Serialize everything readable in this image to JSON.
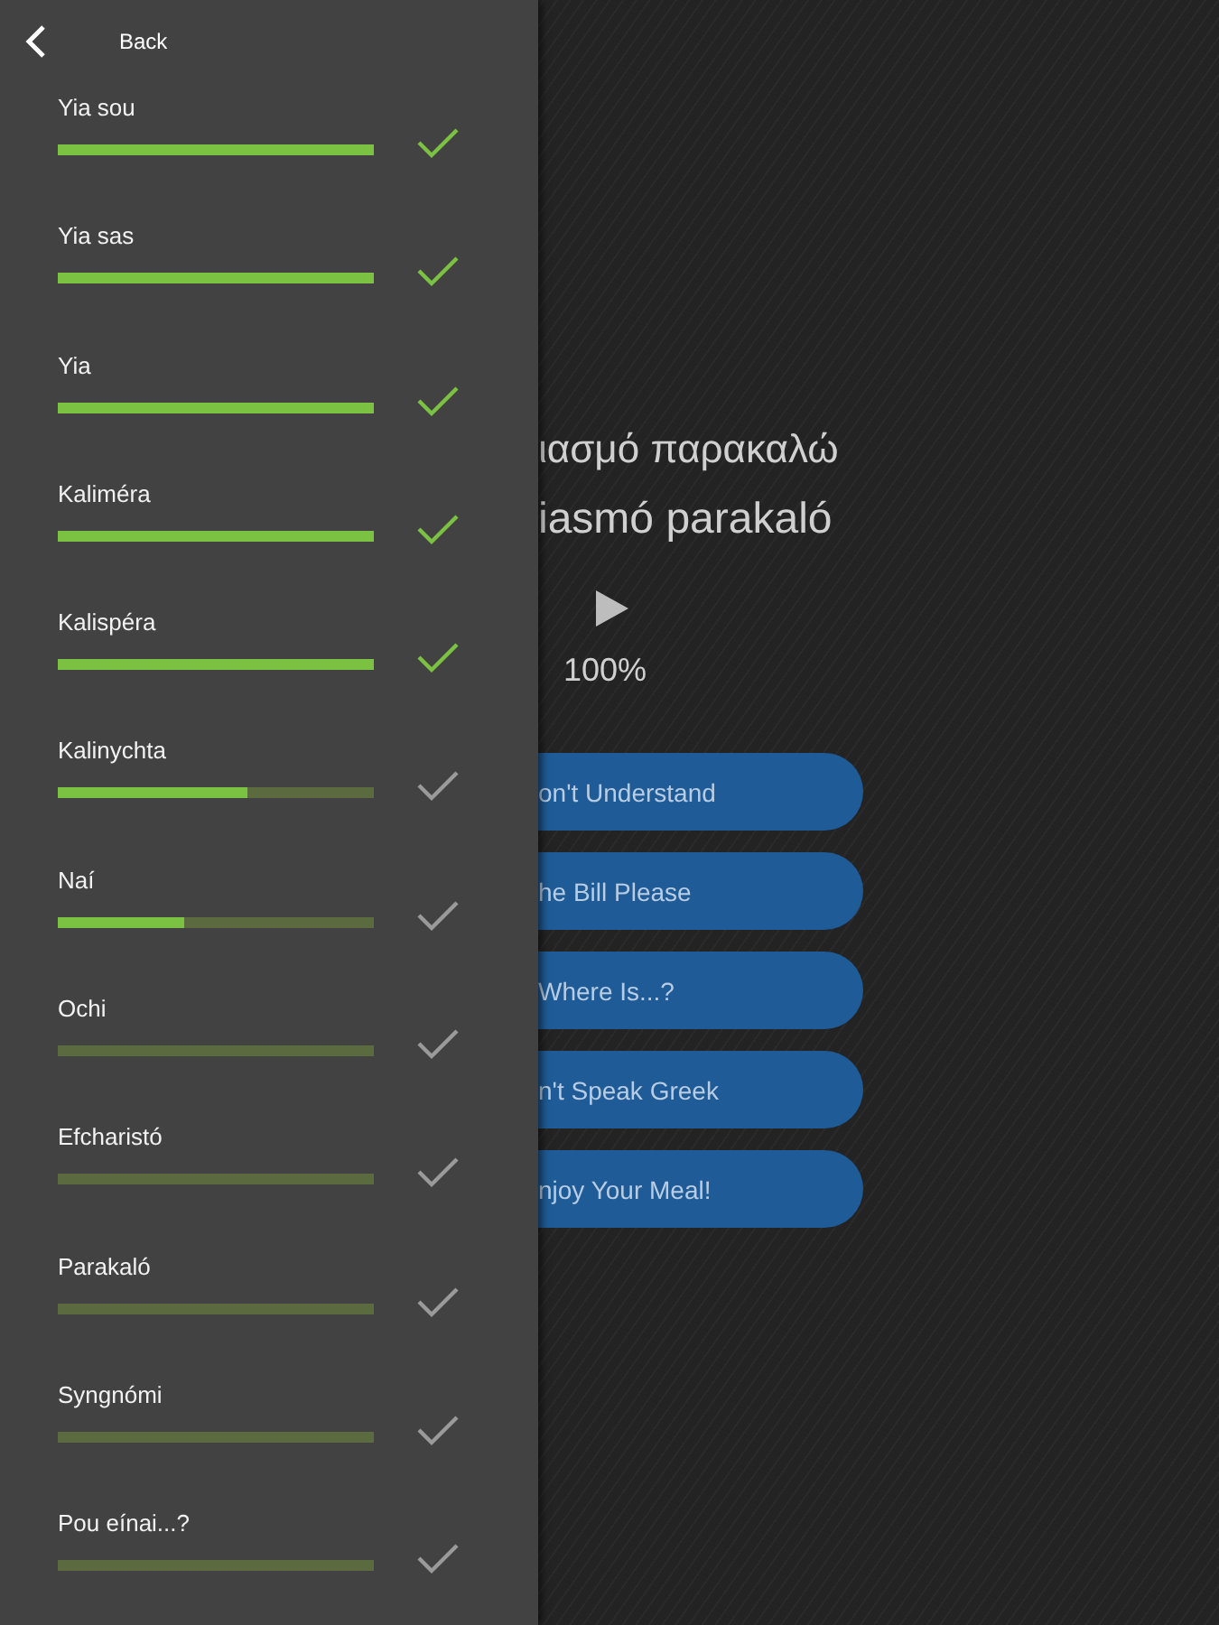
{
  "drawer": {
    "back_label": "Back",
    "phrases": [
      {
        "label": "Yia sou",
        "level": 1,
        "done": true
      },
      {
        "label": "Yia sas",
        "level": 1,
        "done": true
      },
      {
        "label": "Yia",
        "level": 1,
        "done": true
      },
      {
        "label": "Kaliméra",
        "level": 1,
        "done": true
      },
      {
        "label": "Kalispéra",
        "level": 1,
        "done": true
      },
      {
        "label": "Kalinychta",
        "level": 0.6,
        "done": false
      },
      {
        "label": "Naí",
        "level": 0.4,
        "done": false
      },
      {
        "label": "Ochi",
        "level": 0,
        "done": false
      },
      {
        "label": "Efcharistó",
        "level": 0,
        "done": false
      },
      {
        "label": "Parakaló",
        "level": 0,
        "done": false
      },
      {
        "label": "Syngnómi",
        "level": 0,
        "done": false
      },
      {
        "label": "Pou eínai...?",
        "level": 0,
        "done": false
      }
    ]
  },
  "lesson": {
    "greek": "ιασμό παρακαλώ",
    "transliteration": "iasmó parakaló",
    "progress": "100%",
    "options": [
      "on't Understand",
      "he Bill Please",
      "Where Is...?",
      "n't Speak Greek",
      "njoy Your Meal!"
    ]
  }
}
